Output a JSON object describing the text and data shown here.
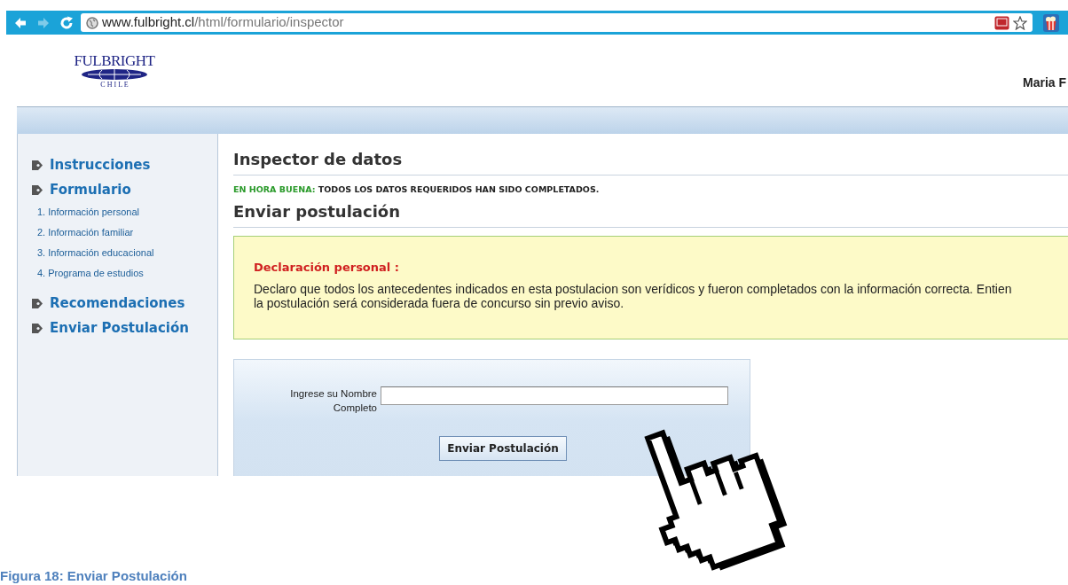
{
  "browser": {
    "nav_buttons": [
      {
        "kind": "back",
        "disabled": false
      },
      {
        "kind": "forward",
        "disabled": true
      },
      {
        "kind": "reload",
        "disabled": false
      }
    ],
    "url": {
      "host": "www.fulbright.cl",
      "path": "/html/formulario/inspector"
    }
  },
  "header": {
    "logo": {
      "title": "FULBRIGHT",
      "subtitle": "C H I L E"
    },
    "user": "Maria F"
  },
  "sidebar": {
    "items": [
      {
        "kind": "section",
        "label": "Instrucciones"
      },
      {
        "kind": "section",
        "label": "Formulario"
      },
      {
        "kind": "sub",
        "label": "1. Información personal"
      },
      {
        "kind": "sub",
        "label": "2. Información familiar"
      },
      {
        "kind": "sub",
        "label": "3. Información educacional"
      },
      {
        "kind": "sub",
        "label": "4. Programa de estudios"
      },
      {
        "kind": "section",
        "label": "Recomendaciones"
      },
      {
        "kind": "section",
        "label": "Enviar Postulación"
      }
    ]
  },
  "main": {
    "title": "Inspector de datos",
    "status": {
      "label": "EN HORA BUENA:",
      "message": "TODOS LOS DATOS REQUERIDOS HAN SIDO COMPLETADOS."
    },
    "section_title": "Enviar postulación",
    "declaration": {
      "title": "Declaración personal :",
      "lines": [
        "Declaro que todos los antecedentes indicados en esta postulacion son verídicos y fueron completados con la información correcta. Entien",
        "la postulación será considerada fuera de concurso sin previo aviso."
      ]
    },
    "form": {
      "label_lines": [
        "Ingrese su Nombre",
        "Completo"
      ],
      "button": "Enviar Postulación"
    }
  },
  "caption": "Figura 18: Enviar Postulación"
}
